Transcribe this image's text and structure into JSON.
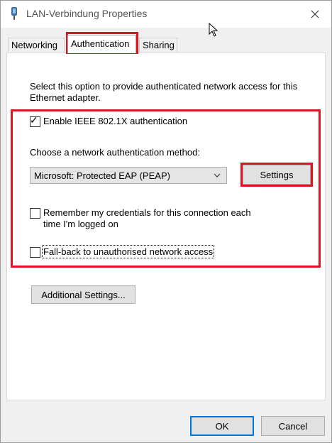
{
  "window": {
    "title": "LAN-Verbindung Properties"
  },
  "tabs": [
    {
      "label": "Networking",
      "active": false
    },
    {
      "label": "Authentication",
      "active": true
    },
    {
      "label": "Sharing",
      "active": false
    }
  ],
  "auth": {
    "description": "Select this option to provide authenticated network access for this Ethernet adapter.",
    "enable_8021x": {
      "label": "Enable IEEE 802.1X authentication",
      "checked": true
    },
    "method_label": "Choose a network authentication method:",
    "method_select": {
      "value": "Microsoft: Protected EAP (PEAP)"
    },
    "settings_button": "Settings",
    "remember_credentials": {
      "label": "Remember my credentials for this connection each time I'm logged on",
      "checked": false
    },
    "fallback": {
      "label": "Fall-back to unauthorised network access",
      "checked": false
    },
    "additional_settings_button": "Additional Settings..."
  },
  "footer": {
    "ok": "OK",
    "cancel": "Cancel"
  },
  "colors": {
    "highlight": "#e0141e",
    "accent": "#0078d7"
  }
}
